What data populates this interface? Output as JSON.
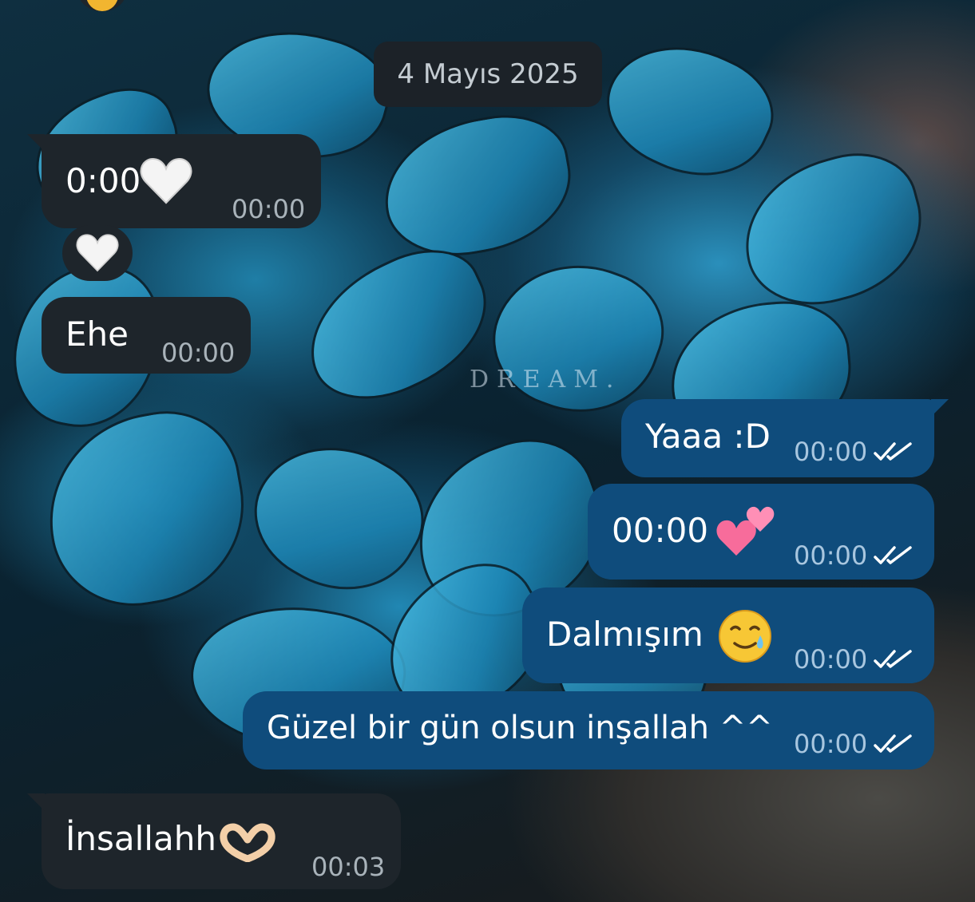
{
  "date_separator": "4 Mayıs 2025",
  "wallpaper_watermark": "DREAM.",
  "messages": [
    {
      "side": "in",
      "text": "0:00",
      "time": "00:00",
      "emoji": "white-heart"
    },
    {
      "side": "in",
      "reaction": "white-heart"
    },
    {
      "side": "in",
      "text": "Ehe",
      "time": "00:00"
    },
    {
      "side": "out",
      "text": "Yaaa :D",
      "time": "00:00",
      "status": "read"
    },
    {
      "side": "out",
      "text": "00:00",
      "time": "00:00",
      "status": "read",
      "emoji": "two-hearts"
    },
    {
      "side": "out",
      "text": "Dalmışım",
      "time": "00:00",
      "status": "read",
      "emoji": "smiling-face-with-tear"
    },
    {
      "side": "out",
      "text": "Güzel bir gün olsun inşallah ^^",
      "time": "00:00",
      "status": "read"
    },
    {
      "side": "in",
      "text": "İnsallahh",
      "time": "00:03",
      "emoji": "heart-hands"
    }
  ],
  "colors": {
    "incoming_bubble": "#1e252b",
    "outgoing_bubble": "#0f4c7c",
    "read_ticks": "#ffffff",
    "date_pill": "#1c2228"
  }
}
